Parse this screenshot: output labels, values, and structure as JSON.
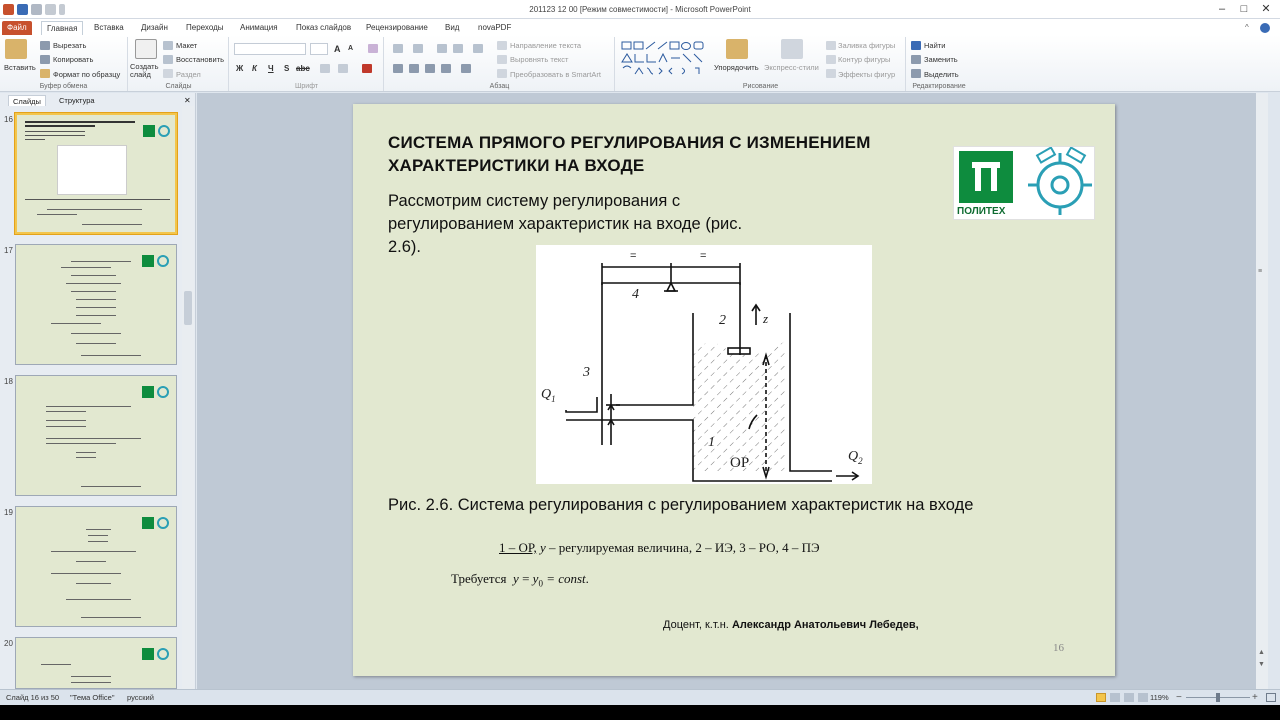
{
  "window": {
    "title": "201123 12 00 [Режим совместимости] - Microsoft PowerPoint"
  },
  "tabs": [
    "Файл",
    "Главная",
    "Вставка",
    "Дизайн",
    "Переходы",
    "Анимация",
    "Показ слайдов",
    "Рецензирование",
    "Вид",
    "novaPDF"
  ],
  "ribbon": {
    "clipboard": {
      "paste": "Вставить",
      "cut": "Вырезать",
      "copy": "Копировать",
      "format_painter": "Формат по образцу",
      "label": "Буфер обмена"
    },
    "slides": {
      "new_slide": "Создать слайд",
      "layout": "Макет",
      "reset": "Восстановить",
      "section": "Раздел",
      "label": "Слайды"
    },
    "font": {
      "label": "Шрифт",
      "bold": "Ж",
      "italic": "К",
      "underline": "Ч",
      "strike": "S",
      "shadow": "abc",
      "grow": "A",
      "shrink": "A"
    },
    "paragraph": {
      "text_direction": "Направление текста",
      "align_text": "Выровнять текст",
      "smartart": "Преобразовать в SmartArt",
      "label": "Абзац"
    },
    "drawing": {
      "arrange": "Упорядочить",
      "quick_styles": "Экспресс-стили",
      "shape_fill": "Заливка фигуры",
      "shape_outline": "Контур фигуры",
      "shape_effects": "Эффекты фигур",
      "label": "Рисование"
    },
    "editing": {
      "find": "Найти",
      "replace": "Заменить",
      "select": "Выделить",
      "label": "Редактирование"
    }
  },
  "left_panel": {
    "tabs": [
      "Слайды",
      "Структура"
    ],
    "thumbnails": [
      {
        "num": "16",
        "selected": true
      },
      {
        "num": "17"
      },
      {
        "num": "18"
      },
      {
        "num": "19"
      },
      {
        "num": "20"
      }
    ]
  },
  "slide": {
    "title": "СИСТЕМА ПРЯМОГО РЕГУЛИРОВАНИЯ С ИЗМЕНЕНИЕМ ХАРАКТЕРИСТИКИ НА ВХОДЕ",
    "body": "Рассмотрим систему регулирования с регулированием характеристик на входе (рис. 2.6).",
    "logo_text": "ПОЛИТЕХ",
    "diagram": {
      "n4": "4",
      "n2": "2",
      "n3": "3",
      "n1": "1",
      "z": "z",
      "q1": "Q",
      "q1_sub": "1",
      "q2": "Q",
      "q2_sub": "2",
      "op": "ОР",
      "eq1": "=",
      "eq2": "="
    },
    "caption": "Рис. 2.6. Система регулирования с регулированием характеристик на входе",
    "line1_underlined": "1 – ОР,",
    "line1_y": "y",
    "line1_rest": " –  регулируемая величина, 2 – ИЭ, 3 – РО, 4 – ПЭ",
    "line2_prefix": "Требуется",
    "line2_formula_y": "y",
    "line2_eq": "=",
    "line2_y0": "y",
    "line2_sub": "0",
    "line2_const": "= const",
    "line2_dot": ".",
    "author_title": "Доцент, к.т.н.",
    "author_name": "Александр Анатольевич Лебедев,",
    "number": "16"
  },
  "status": {
    "slide_info": "Слайд 16 из 50",
    "theme": "\"Тема Office\"",
    "language": "русский",
    "zoom": "119%"
  },
  "colors": {
    "file_tab": "#c7502d",
    "slide_bg": "#e2e8d0",
    "logo_green": "#0e8c3e",
    "logo_teal": "#2a9fb5"
  }
}
